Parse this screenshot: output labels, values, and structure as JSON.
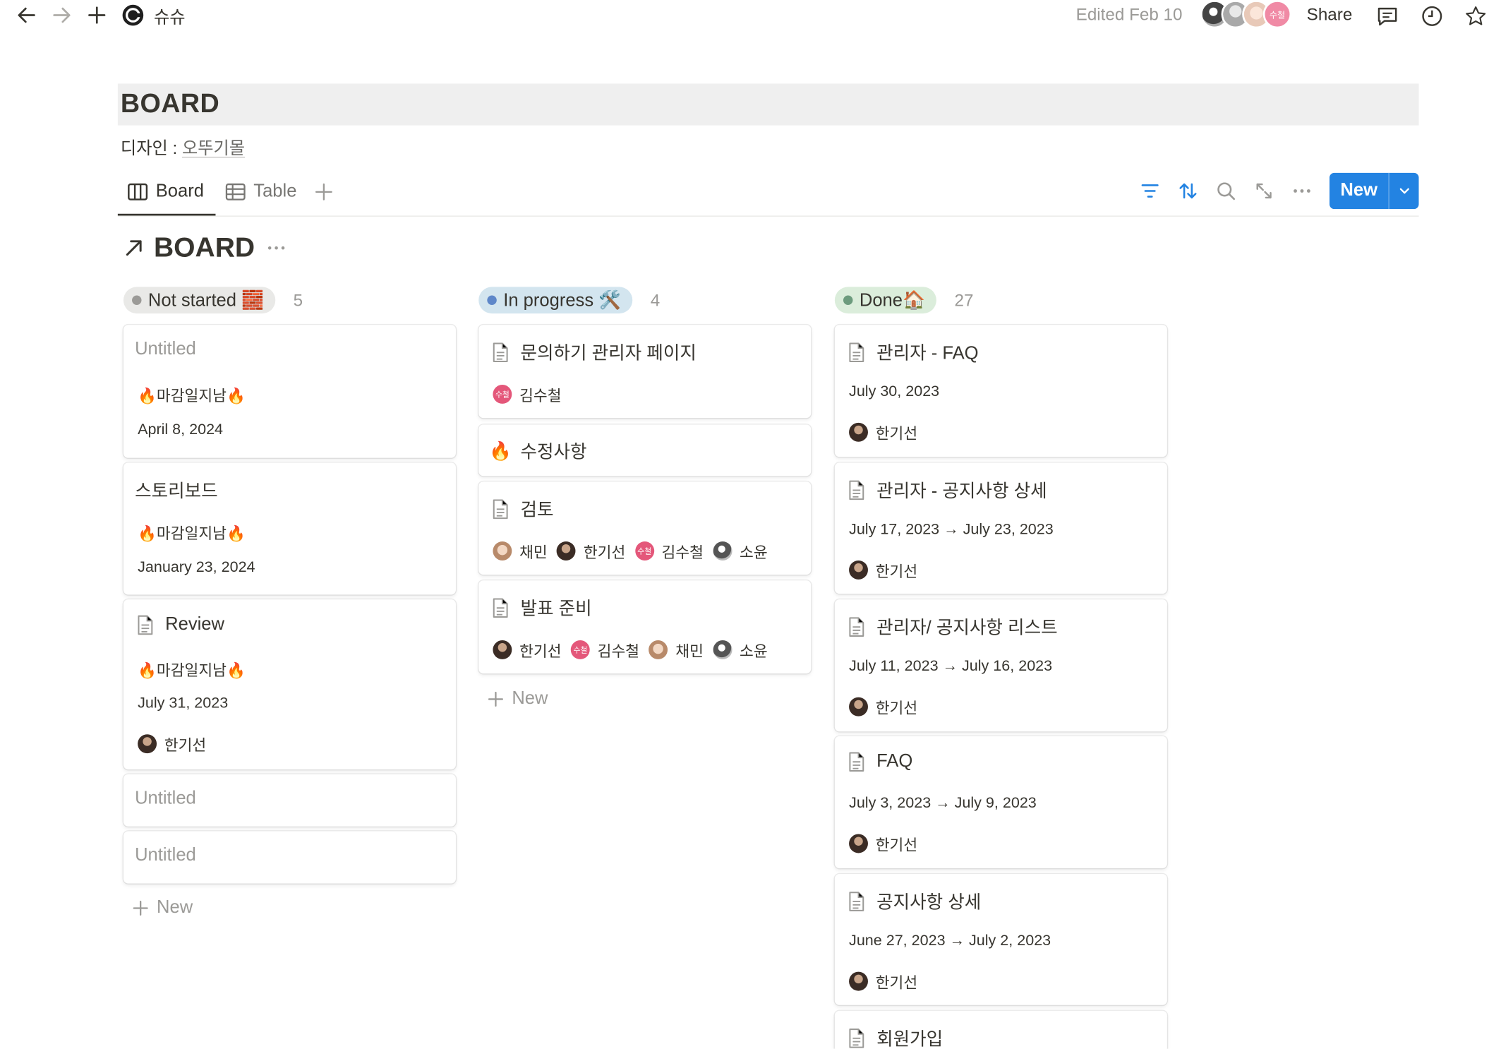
{
  "topbar": {
    "workspace": "슈슈",
    "edited": "Edited Feb 10",
    "avatar_badge": "수철",
    "share": "Share"
  },
  "page": {
    "title": "BOARD",
    "description_label": "디자인 : ",
    "description_link": "오뚜기몰"
  },
  "views": {
    "tabs": [
      {
        "label": "Board",
        "icon": "board-icon"
      },
      {
        "label": "Table",
        "icon": "table-icon"
      }
    ],
    "new_button": "New",
    "view_title": "BOARD"
  },
  "board": {
    "columns": [
      {
        "name": "Not started 🧱",
        "count": "5",
        "color": "#9b9a97",
        "pill_bg": "#e9e9e7",
        "cards": [
          {
            "title": "Untitled",
            "tag": "🔥마감일지남🔥",
            "date": "April 8, 2024"
          },
          {
            "title": "스토리보드",
            "tag": "🔥마감일지남🔥",
            "date": "January 23, 2024"
          },
          {
            "title": "Review",
            "tag": "🔥마감일지남🔥",
            "date": "July 31, 2023",
            "person": "한기선"
          },
          {
            "title": "Untitled"
          },
          {
            "title": "Untitled"
          }
        ],
        "add_label": "New"
      },
      {
        "name": "In progress 🛠️",
        "count": "4",
        "color": "#5e87c9",
        "pill_bg": "#d3e5ef",
        "cards": [
          {
            "title": "문의하기 관리자 페이지",
            "people": [
              "김수철"
            ],
            "badge": "수철"
          },
          {
            "title": "수정사항",
            "icon": "🔥"
          },
          {
            "title": "검토",
            "people": [
              "채민",
              "한기선",
              "김수철",
              "소윤"
            ]
          },
          {
            "title": "발표 준비",
            "people": [
              "한기선",
              "김수철",
              "채민",
              "소윤"
            ]
          }
        ],
        "add_label": "New"
      },
      {
        "name": "Done🏠",
        "count": "27",
        "color": "#6c9b7d",
        "pill_bg": "#dbeddb",
        "cards": [
          {
            "title": "관리자 - FAQ",
            "date": "July 30, 2023",
            "person": "한기선"
          },
          {
            "title": "관리자 - 공지사항 상세",
            "date": "July 17, 2023 → July 23, 2023",
            "person": "한기선"
          },
          {
            "title": "관리자/ 공지사항 리스트",
            "date": "July 11, 2023 → July 16, 2023",
            "person": "한기선"
          },
          {
            "title": "FAQ",
            "date": "July 3, 2023 → July 9, 2023",
            "person": "한기선"
          },
          {
            "title": "공지사항 상세",
            "date": "June 27, 2023 → July 2, 2023",
            "person": "한기선"
          },
          {
            "title": "회원가입"
          }
        ]
      }
    ]
  }
}
